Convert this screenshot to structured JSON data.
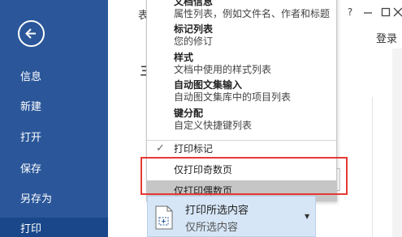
{
  "sidebar": {
    "items": [
      {
        "label": "信息"
      },
      {
        "label": "新建"
      },
      {
        "label": "打开"
      },
      {
        "label": "保存"
      },
      {
        "label": "另存为"
      },
      {
        "label": "打印"
      }
    ]
  },
  "header": {
    "title_partial": "表",
    "heading_partial": "丰",
    "login": "登录"
  },
  "dropdown": {
    "entries": [
      {
        "title": "文档信息",
        "desc": "属性列表，例如文件名、作者和标题"
      },
      {
        "title": "标记列表",
        "desc": "您的修订"
      },
      {
        "title": "样式",
        "desc": "文档中使用的样式列表"
      },
      {
        "title": "自动图文集输入",
        "desc": "自动图文集库中的项目列表"
      },
      {
        "title": "键分配",
        "desc": "自定义快捷键列表"
      }
    ],
    "options": [
      {
        "label": "打印标记",
        "checked": true
      },
      {
        "label": "仅打印奇数页",
        "checked": false
      },
      {
        "label": "仅打印偶数页",
        "checked": false,
        "hovered": true
      }
    ]
  },
  "print_range": {
    "title": "打印所选内容",
    "subtitle": "仅所选内容"
  },
  "colors": {
    "sidebar_bg": "#2b579a",
    "sidebar_active": "#19478a",
    "highlight": "#e53935",
    "button_bg": "#d6e6f7"
  }
}
